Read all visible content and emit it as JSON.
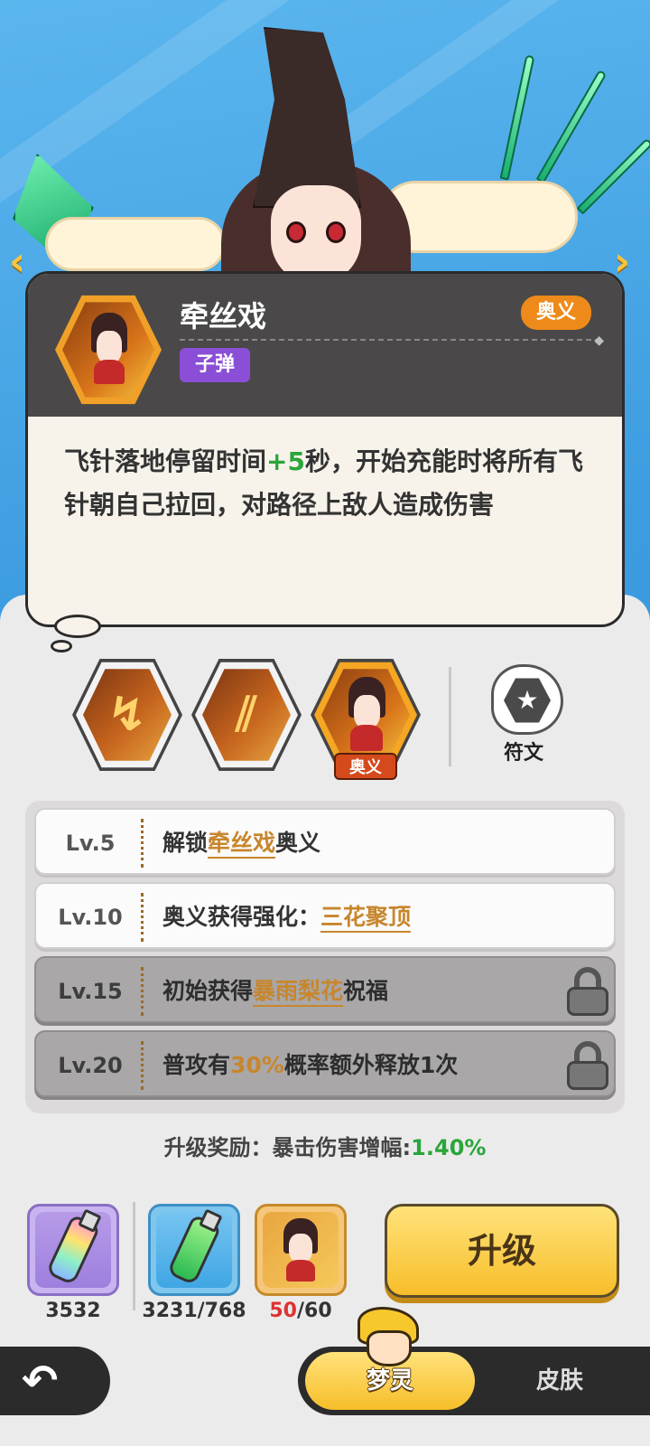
{
  "card": {
    "skill_name": "牵丝戏",
    "badge_aoyi": "奥义",
    "badge_type": "子弹",
    "desc_part1": "飞针落地停留时间",
    "desc_bonus": "+5",
    "desc_part2": "秒，开始充能时将所有飞针朝自己拉回，对路径上敌人造成伤害"
  },
  "skills": {
    "selected_tag": "奥义",
    "rune_label": "符文"
  },
  "levels": [
    {
      "lv": "Lv.5",
      "pre": "解锁",
      "hl": "牵丝戏",
      "post": "奥义",
      "locked": false
    },
    {
      "lv": "Lv.10",
      "pre": "奥义获得强化：",
      "hl": "三花聚顶",
      "post": "",
      "locked": false
    },
    {
      "lv": "Lv.15",
      "pre": "初始获得",
      "hl": "暴雨梨花",
      "post": "祝福",
      "locked": true
    },
    {
      "lv": "Lv.20",
      "pre": "普攻有",
      "hl": "30%",
      "post": "概率额外释放1次",
      "locked": true
    }
  ],
  "bonus": {
    "label": "升级奖励：暴击伤害增幅:",
    "value": "1.40%"
  },
  "items": [
    {
      "icon": "rainbow-bottle-icon",
      "count": "3532"
    },
    {
      "icon": "green-bottle-icon",
      "count": "3231/768"
    },
    {
      "icon": "character-shard-icon",
      "have": "50",
      "need": "/60"
    }
  ],
  "upgrade_label": "升级",
  "nav": {
    "back_icon": "back-arrow-icon",
    "tab_active": "梦灵",
    "tab_inactive": "皮肤"
  },
  "colors": {
    "accent": "#f7be2a",
    "green": "#2aa63a",
    "highlight": "#c8862c",
    "type_badge": "#8a4fd6"
  }
}
